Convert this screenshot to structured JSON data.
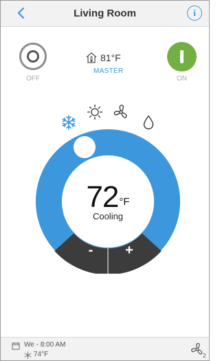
{
  "header": {
    "title": "Living Room",
    "back_icon": "chevron-left-icon",
    "info_icon": "info-icon",
    "info_glyph": "i"
  },
  "power": {
    "off_label": "OFF",
    "on_label": "ON"
  },
  "house": {
    "temp": "81°F",
    "label": "MASTER"
  },
  "modes": [
    "cool-snowflake-icon",
    "heat-sun-icon",
    "fan-icon",
    "dry-droplet-icon"
  ],
  "thermostat": {
    "set_temp": "72",
    "unit": "°F",
    "mode_text": "Cooling",
    "minus_label": "-",
    "plus_label": "+"
  },
  "footer": {
    "schedule_day": "We - 8:00 AM",
    "schedule_temp": "74°F",
    "zone_badge": "2"
  },
  "colors": {
    "accent": "#3a97db",
    "ring": "#3d97dc",
    "on": "#72b043",
    "controls": "#3c3c3c"
  }
}
